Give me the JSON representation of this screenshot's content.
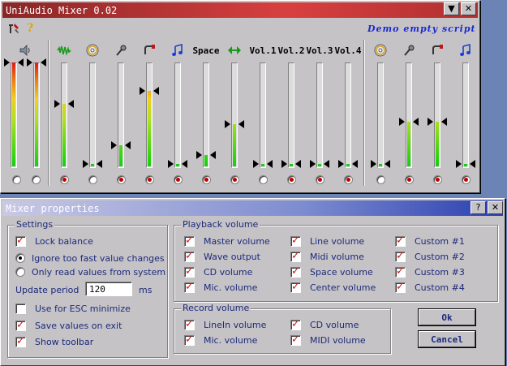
{
  "mixer": {
    "title": "UniAudio Mixer 0.02",
    "script_label": "Demo empty script",
    "faders": [
      {
        "header": "",
        "icon": "speaker-icon",
        "levels": [
          1.0,
          1.0
        ],
        "radio": false
      },
      {
        "header": "",
        "icon": "wave-icon",
        "level": 0.6,
        "radio": true
      },
      {
        "header": "",
        "icon": "cd-icon",
        "level": 0.02,
        "radio": false
      },
      {
        "header": "",
        "icon": "microphone-icon",
        "level": 0.2,
        "radio": true
      },
      {
        "header": "",
        "icon": "line-in-icon",
        "level": 0.73,
        "radio": true
      },
      {
        "header": "",
        "icon": "midi-note-icon",
        "level": 0.02,
        "radio": true
      },
      {
        "header": "Space",
        "icon": "",
        "level": 0.11,
        "radio": true
      },
      {
        "header": "",
        "icon": "center-arrows-icon",
        "level": 0.41,
        "radio": true
      },
      {
        "header": "Vol.1",
        "icon": "",
        "level": 0.02,
        "radio": false
      },
      {
        "header": "Vol.2",
        "icon": "",
        "level": 0.02,
        "radio": true
      },
      {
        "header": "Vol.3",
        "icon": "",
        "level": 0.02,
        "radio": true
      },
      {
        "header": "Vol.4",
        "icon": "",
        "level": 0.02,
        "radio": true
      },
      {
        "header": "",
        "icon": "cd-icon",
        "level": 0.02,
        "radio": false
      },
      {
        "header": "",
        "icon": "microphone-icon",
        "level": 0.43,
        "radio": true
      },
      {
        "header": "",
        "icon": "line-in-icon",
        "level": 0.43,
        "radio": true
      },
      {
        "header": "",
        "icon": "midi-note-icon",
        "level": 0.02,
        "radio": true
      }
    ]
  },
  "props": {
    "title": "Mixer properties",
    "settings": {
      "title": "Settings",
      "lock_balance": "Lock balance",
      "ignore_fast": "Ignore too fast value changes",
      "only_read": "Only read values from system",
      "update_period_label": "Update period",
      "update_period_value": "120",
      "update_period_unit": "ms",
      "esc_minimize": "Use for ESC minimize",
      "save_on_exit": "Save values on exit",
      "show_toolbar": "Show toolbar"
    },
    "playback": {
      "title": "Playback volume",
      "col1": [
        "Master volume",
        "Wave output",
        "CD volume",
        "Mic. volume"
      ],
      "col2": [
        "Line volume",
        "Midi volume",
        "Space volume",
        "Center volume"
      ],
      "col3": [
        "Custom #1",
        "Custom #2",
        "Custom #3",
        "Custom #4"
      ]
    },
    "record": {
      "title": "Record volume",
      "col1": [
        "LineIn volume",
        "Mic. volume"
      ],
      "col2": [
        "CD volume",
        "MIDI volume"
      ]
    },
    "ok_label": "Ok",
    "cancel_label": "Cancel"
  }
}
